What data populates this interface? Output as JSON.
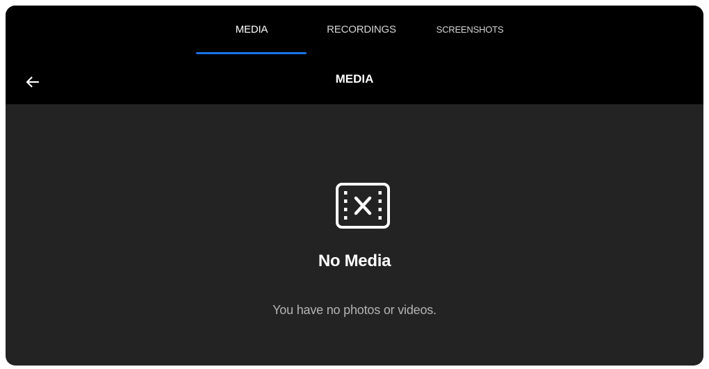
{
  "tabs": [
    {
      "label": "MEDIA",
      "active": true
    },
    {
      "label": "RECORDINGS",
      "active": false
    },
    {
      "label": "SCREENSHOTS",
      "active": false
    }
  ],
  "header": {
    "title": "MEDIA",
    "back_icon": "arrow-left-icon"
  },
  "empty_state": {
    "icon": "video-off-icon",
    "title": "No Media",
    "message": "You have no photos or videos."
  },
  "colors": {
    "accent": "#1a73e8",
    "topbar_bg": "#000000",
    "content_bg": "#232323"
  }
}
